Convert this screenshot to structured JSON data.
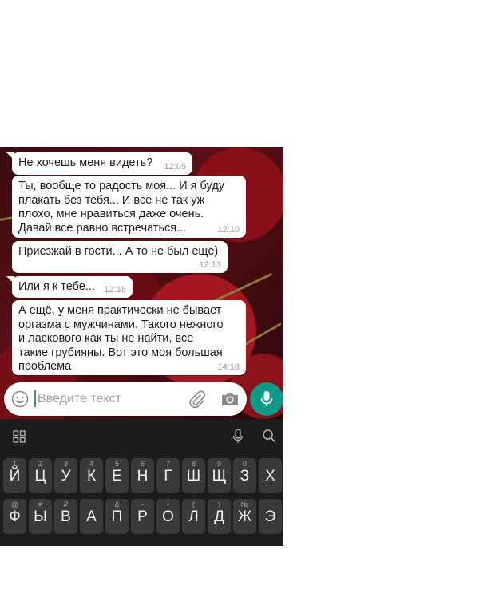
{
  "messages": [
    {
      "text": "Не хочешь меня видеть?",
      "time": "12:05"
    },
    {
      "text": "Ты, вообще то радость моя... И я буду\nплакать без тебя... И все не так уж\nплохо, мне нравиться даже очень.\nДавай все равно встречаться...",
      "time": "12:10"
    },
    {
      "text": "Приезжай в гости... А то не был ещё)",
      "time": "12:13"
    },
    {
      "text": "Или я к тебе...",
      "time": "12:18"
    },
    {
      "text": "А ещё, у меня практически не бывает\nоргазма с мужчинами. Такого нежного\nи ласкового как ты не найти, все\nтакие грубияны. Вот это моя большая\nпроблема",
      "time": "14:18"
    }
  ],
  "composer": {
    "placeholder": "Введите текст",
    "emoji_icon": "emoji-icon",
    "attach_icon": "paperclip-icon",
    "camera_icon": "camera-icon",
    "mic_icon": "microphone-icon",
    "accent_color": "#0e9a86"
  },
  "keyboard": {
    "toolbar_icons": [
      "grid-icon",
      "microphone-icon",
      "search-icon"
    ],
    "row1": [
      {
        "hint": "1",
        "letter": "Й"
      },
      {
        "hint": "2",
        "letter": "Ц"
      },
      {
        "hint": "3",
        "letter": "У"
      },
      {
        "hint": "4",
        "letter": "К"
      },
      {
        "hint": "5",
        "letter": "Е"
      },
      {
        "hint": "6",
        "letter": "Н"
      },
      {
        "hint": "7",
        "letter": "Г"
      },
      {
        "hint": "8",
        "letter": "Ш"
      },
      {
        "hint": "9",
        "letter": "Щ"
      },
      {
        "hint": "0",
        "letter": "З"
      },
      {
        "hint": "",
        "letter": "Х"
      }
    ],
    "row2": [
      {
        "hint": "@",
        "letter": "Ф"
      },
      {
        "hint": "#",
        "letter": "Ы"
      },
      {
        "hint": "₽",
        "letter": "В"
      },
      {
        "hint": "_",
        "letter": "А"
      },
      {
        "hint": "&",
        "letter": "П"
      },
      {
        "hint": "-",
        "letter": "Р"
      },
      {
        "hint": "+",
        "letter": "О"
      },
      {
        "hint": "(",
        "letter": "Л"
      },
      {
        "hint": ")",
        "letter": "Д"
      },
      {
        "hint": "№",
        "letter": "Ж"
      },
      {
        "hint": "",
        "letter": "Э"
      }
    ]
  }
}
